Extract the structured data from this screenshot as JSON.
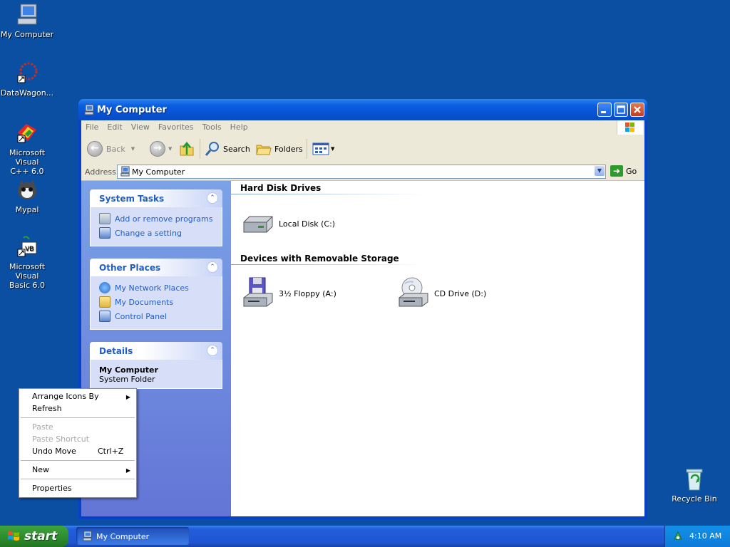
{
  "desktop": {
    "icons": [
      {
        "label_line1": "My Computer",
        "label_line2": "",
        "icon": "my-computer-icon"
      },
      {
        "label_line1": "DataWagon...",
        "label_line2": "",
        "icon": "datawagon-icon"
      },
      {
        "label_line1": "Microsoft Visual",
        "label_line2": "C++ 6.0",
        "icon": "visual-cpp-icon"
      },
      {
        "label_line1": "Mypal",
        "label_line2": "",
        "icon": "mypal-icon"
      },
      {
        "label_line1": "Microsoft Visual",
        "label_line2": "Basic 6.0",
        "icon": "visual-basic-icon"
      },
      {
        "label_line1": "Recycle Bin",
        "label_line2": "",
        "icon": "recycle-bin-icon"
      }
    ]
  },
  "window": {
    "title": "My Computer",
    "menu": [
      "File",
      "Edit",
      "View",
      "Favorites",
      "Tools",
      "Help"
    ],
    "toolbar": {
      "back": "Back",
      "search": "Search",
      "folders": "Folders"
    },
    "address": {
      "label": "Address",
      "value": "My Computer",
      "go": "Go"
    },
    "tasks": {
      "system_tasks": {
        "title": "System Tasks",
        "links": [
          "Add or remove programs",
          "Change a setting"
        ]
      },
      "other_places": {
        "title": "Other Places",
        "links": [
          "My Network Places",
          "My Documents",
          "Control Panel"
        ]
      },
      "details": {
        "title": "Details",
        "name": "My Computer",
        "type": "System Folder"
      }
    },
    "content": {
      "hard_disk_header": "Hard Disk Drives",
      "removable_header": "Devices with Removable Storage",
      "local_disk": "Local Disk (C:)",
      "floppy": "3½ Floppy (A:)",
      "cd_drive": "CD Drive (D:)"
    }
  },
  "context_menu": {
    "arrange": "Arrange Icons By",
    "refresh": "Refresh",
    "paste": "Paste",
    "paste_shortcut": "Paste Shortcut",
    "undo_move": "Undo Move",
    "undo_shortcut": "Ctrl+Z",
    "new": "New",
    "properties": "Properties"
  },
  "taskbar": {
    "start": "start",
    "task_title": "My Computer",
    "clock": "4:10 AM"
  },
  "colors": {
    "desktop": "#0b4fa3",
    "title_bar": "#0752d4",
    "start_green": "#2f8f2f",
    "task_link": "#215dc6"
  }
}
